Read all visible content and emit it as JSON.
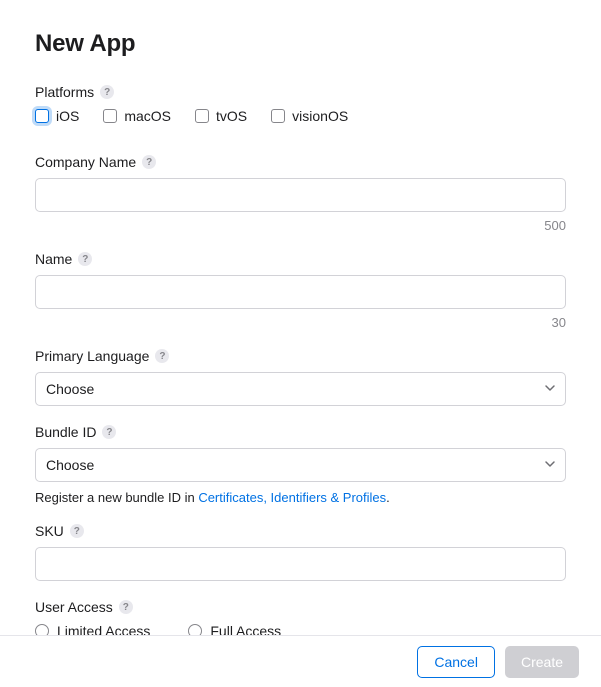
{
  "title": "New App",
  "platforms": {
    "label": "Platforms",
    "options": [
      {
        "label": "iOS"
      },
      {
        "label": "macOS"
      },
      {
        "label": "tvOS"
      },
      {
        "label": "visionOS"
      }
    ]
  },
  "company_name": {
    "label": "Company Name",
    "value": "",
    "max": "500"
  },
  "name": {
    "label": "Name",
    "value": "",
    "max": "30"
  },
  "primary_language": {
    "label": "Primary Language",
    "selected": "Choose"
  },
  "bundle_id": {
    "label": "Bundle ID",
    "selected": "Choose",
    "hint_prefix": "Register a new bundle ID in ",
    "hint_link": "Certificates, Identifiers & Profiles",
    "hint_suffix": "."
  },
  "sku": {
    "label": "SKU",
    "value": ""
  },
  "user_access": {
    "label": "User Access",
    "options": [
      {
        "label": "Limited Access"
      },
      {
        "label": "Full Access"
      }
    ]
  },
  "footer": {
    "cancel": "Cancel",
    "create": "Create"
  }
}
